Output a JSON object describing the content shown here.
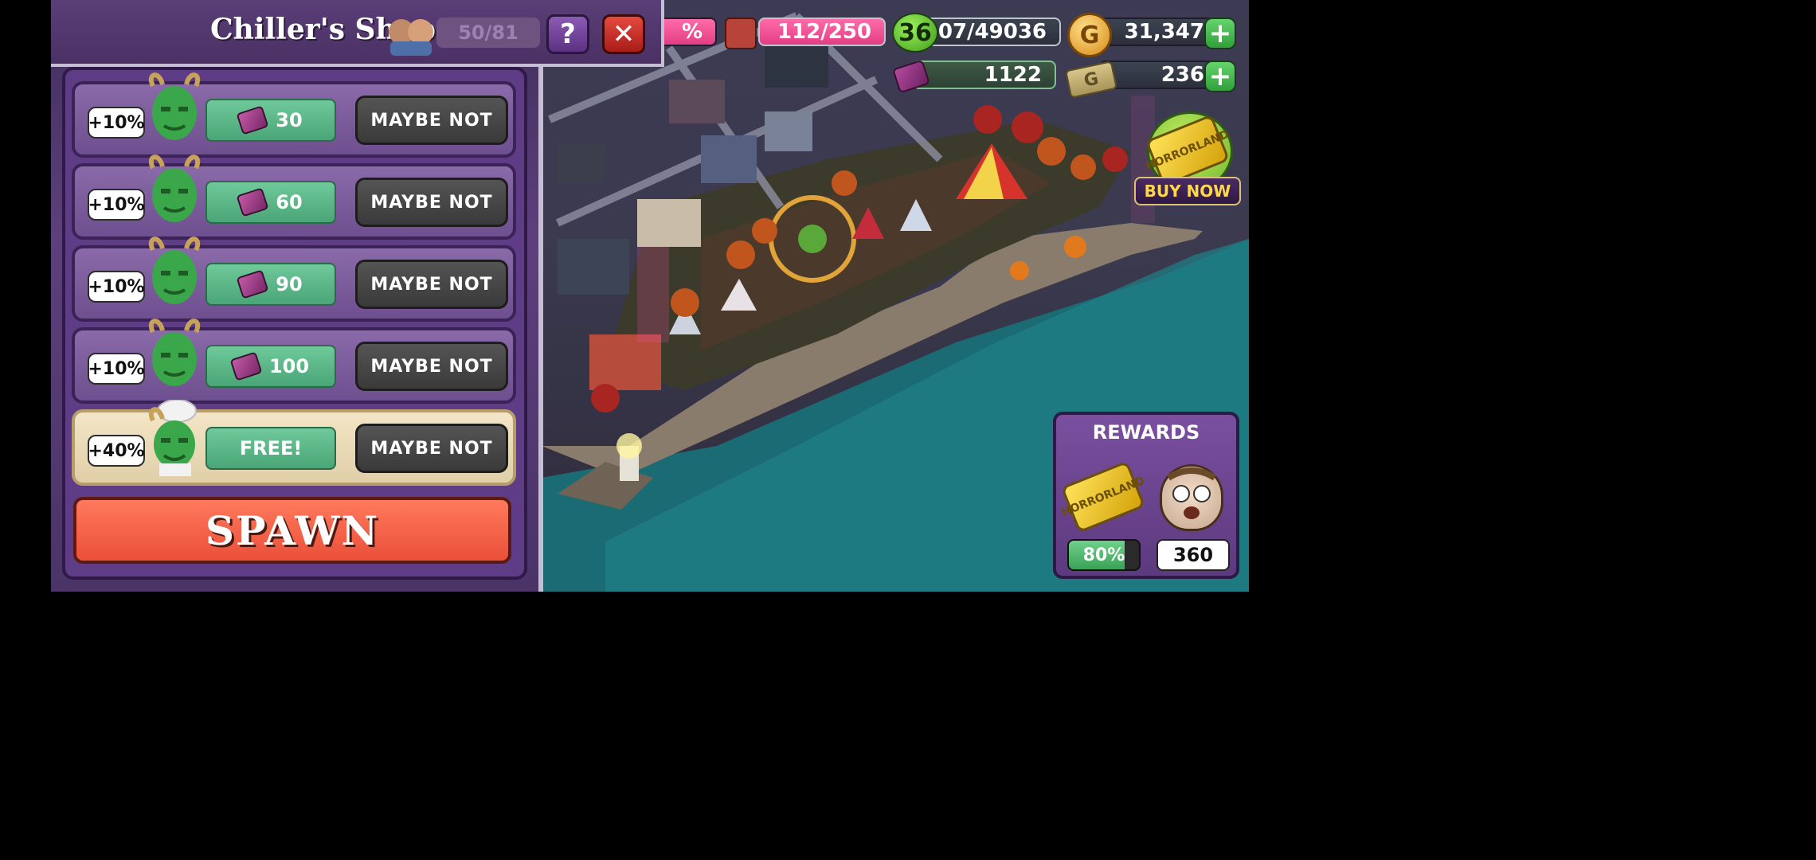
{
  "hud": {
    "pink_bar_value": "%",
    "population": "112/250",
    "level": "36",
    "xp": "42007/49036",
    "coins": "31,347",
    "tickets": "1122",
    "cash": "236",
    "plus_symbol": "+",
    "coin_symbol": "G",
    "cash_symbol": "G"
  },
  "shop": {
    "title": "Chiller's Shop",
    "capacity": "50/81",
    "help_label": "?",
    "close_label": "✕",
    "rows": [
      {
        "bonus": "+10%",
        "price": "30",
        "decline": "MAYBE NOT"
      },
      {
        "bonus": "+10%",
        "price": "60",
        "decline": "MAYBE NOT"
      },
      {
        "bonus": "+10%",
        "price": "90",
        "decline": "MAYBE NOT"
      },
      {
        "bonus": "+10%",
        "price": "100",
        "decline": "MAYBE NOT"
      },
      {
        "bonus": "+40%",
        "price": "FREE!",
        "decline": "MAYBE NOT"
      }
    ],
    "spawn_label": "SPAWN"
  },
  "promo": {
    "buy_label": "BUY NOW",
    "ticket_text": "HORRORLAND"
  },
  "rewards": {
    "title": "REWARDS",
    "progress_label": "80%",
    "progress_fraction": 0.8,
    "count": "360",
    "ticket_text": "HORRORLAND"
  },
  "colors": {
    "accent_green": "#4aa677",
    "spawn_red": "#ea4f3a",
    "panel_purple": "#5f3c86"
  }
}
